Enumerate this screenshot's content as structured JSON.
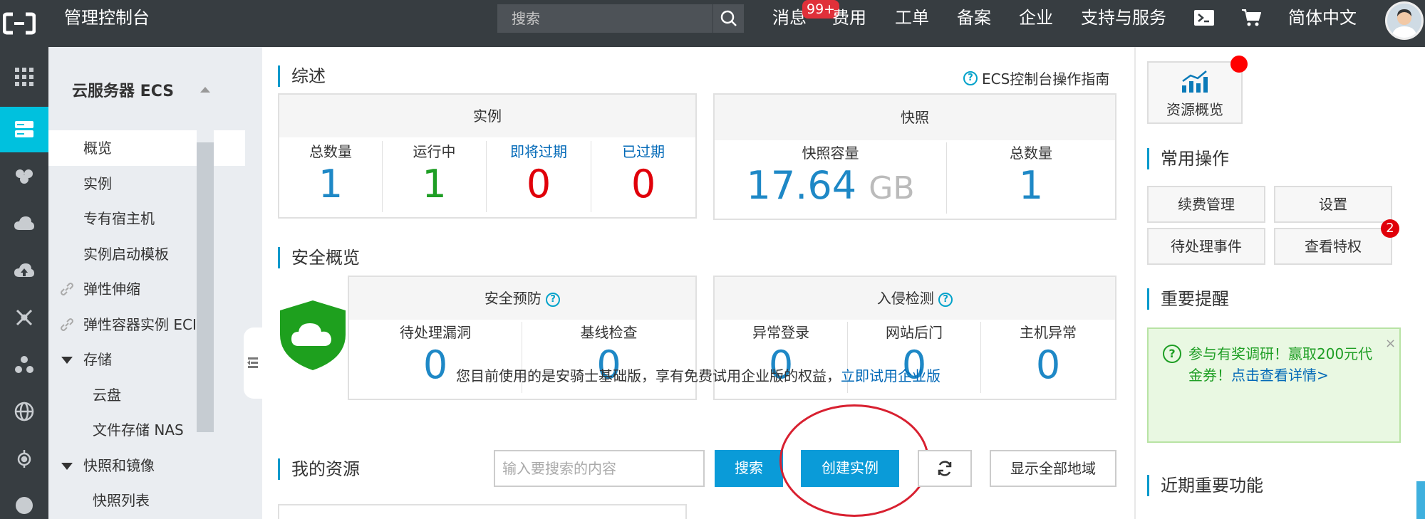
{
  "header": {
    "console_title": "管理控制台",
    "search_placeholder": "搜索",
    "nav": [
      "消息",
      "费用",
      "工单",
      "备案",
      "企业",
      "支持与服务"
    ],
    "message_badge": "99+",
    "language": "简体中文"
  },
  "sidebar": {
    "title": "云服务器 ECS",
    "items": [
      "概览",
      "实例",
      "专有宿主机",
      "实例启动模板",
      "弹性伸缩",
      "弹性容器实例 ECI",
      "存储",
      "云盘",
      "文件存储 NAS",
      "快照和镜像",
      "快照列表"
    ]
  },
  "overview": {
    "title": "综述",
    "guide_link": "ECS控制台操作指南",
    "instance": {
      "header": "实例",
      "stats": [
        {
          "label": "总数量",
          "value": "1"
        },
        {
          "label": "运行中",
          "value": "1"
        },
        {
          "label": "即将过期",
          "value": "0"
        },
        {
          "label": "已过期",
          "value": "0"
        }
      ]
    },
    "snapshot": {
      "header": "快照",
      "capacity_label": "快照容量",
      "capacity_value": "17.64",
      "capacity_unit": "GB",
      "count_label": "总数量",
      "count_value": "1"
    }
  },
  "security": {
    "title": "安全概览",
    "prevention": {
      "header": "安全预防",
      "stats": [
        {
          "label": "待处理漏洞",
          "value": "0"
        },
        {
          "label": "基线检查",
          "value": "0"
        }
      ]
    },
    "intrusion": {
      "header": "入侵检测",
      "stats": [
        {
          "label": "异常登录",
          "value": "0"
        },
        {
          "label": "网站后门",
          "value": "0"
        },
        {
          "label": "主机异常",
          "value": "0"
        }
      ]
    },
    "notice": "您目前使用的是安骑士基础版，享有免费试用企业版的权益，",
    "notice_link": "立即试用企业版"
  },
  "resources": {
    "title": "我的资源",
    "search_placeholder": "输入要搜索的内容",
    "search_button": "搜索",
    "create_button": "创建实例",
    "show_all_button": "显示全部地域"
  },
  "right_panel": {
    "overview_button": "资源概览",
    "common_ops_title": "常用操作",
    "ops": [
      "续费管理",
      "设置",
      "待处理事件",
      "查看特权"
    ],
    "privilege_badge": "2",
    "reminder_title": "重要提醒",
    "reminder_text": "参与有奖调研！赢取200元代金券！",
    "reminder_link": "点击查看详情>",
    "reminder_close": "×",
    "recent_title": "近期重要功能"
  },
  "colors": {
    "topbar": "#373d41",
    "accent": "#00c1de",
    "primary_button": "#0a9bd8",
    "link": "#0068b7",
    "value_blue": "#1e88c6",
    "value_green": "#1e9e24",
    "value_red": "#e0000a"
  },
  "icons": [
    "aliyun-logo",
    "search-icon",
    "terminal-icon",
    "cart-icon",
    "grid-icon",
    "server-icon",
    "shield-cloud-icon",
    "refresh-icon",
    "chart-icon"
  ]
}
